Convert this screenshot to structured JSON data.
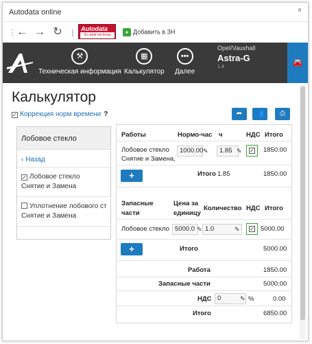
{
  "window": {
    "title": "Autodata online",
    "pin_icon": "pin-icon"
  },
  "toolbar": {
    "logo_text": "Autodata",
    "logo_tagline": "It's what we know",
    "add_label": "Добавить в ЗН"
  },
  "navbar": {
    "items": [
      {
        "label": "Техническая информация",
        "icon": "wrench-icon"
      },
      {
        "label": "Калькулятор",
        "icon": "calculator-icon"
      },
      {
        "label": "Далее",
        "icon": "more-icon"
      }
    ],
    "vehicle": {
      "make": "Opel/Vauxhall",
      "model": "Astra-G",
      "engine": "1.4"
    }
  },
  "page": {
    "title": "Калькулятор",
    "correction_label": "Коррекция норм времени",
    "help": "?"
  },
  "sidebar": {
    "heading": "Лобовое стекло",
    "back": "Назад",
    "options": [
      {
        "line1": "Лобовое стекло",
        "line2": "Снятие и Замена",
        "checked": true
      },
      {
        "line1": "Уплотнение лобового ст",
        "line2": "Снятие и Замена",
        "checked": false
      }
    ]
  },
  "labor": {
    "headers": {
      "work": "Работы",
      "norm": "Нормо-час",
      "hours": "ч",
      "vat": "НДС",
      "total": "Итого"
    },
    "row": {
      "name_line1": "Лобовое стекло",
      "name_line2": "Снятие и Замена,",
      "norm": "1000.00",
      "hours": "1.85",
      "total": "1850.00"
    },
    "subtotal": {
      "label": "Итого",
      "hours": "1.85",
      "amount": "1850.00"
    }
  },
  "parts": {
    "headers": {
      "parts_line1": "Запасные",
      "parts_line2": "части",
      "price_line1": "Цена за",
      "price_line2": "единицу",
      "qty": "Количество",
      "vat": "НДС",
      "total": "Итого"
    },
    "row": {
      "name": "Лобовое стекло",
      "price": "5000.0",
      "qty": "1.0",
      "total": "5000.00"
    },
    "subtotal": {
      "label": "Итого",
      "amount": "5000.00"
    }
  },
  "summary": {
    "work_label": "Работа",
    "work_value": "1850.00",
    "parts_label": "Запасные части",
    "parts_value": "5000.00",
    "vat_label": "НДС",
    "vat_rate": "0",
    "vat_pct": "%",
    "vat_value": "0.00",
    "total_label": "Итого",
    "total_value": "6850.00"
  },
  "colors": {
    "accent": "#1f7bbf",
    "navbar": "#3a3a3a",
    "check": "#3aa33a",
    "logo": "#c8102e"
  }
}
